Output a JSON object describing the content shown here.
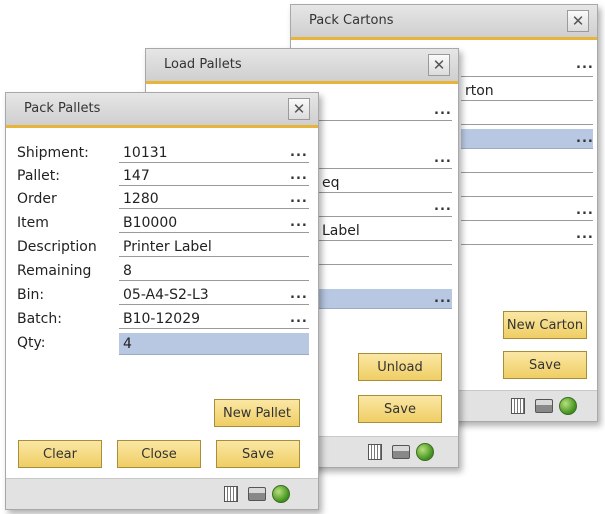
{
  "pack_cartons": {
    "title": "Pack Cartons",
    "partial_texts": [
      "rton"
    ],
    "buttons": {
      "new_carton": "New Carton",
      "save": "Save"
    }
  },
  "load_pallets": {
    "title": "Load Pallets",
    "partial_texts": [
      "eq",
      "Label"
    ],
    "buttons": {
      "unload": "Unload",
      "save": "Save"
    }
  },
  "pack_pallets": {
    "title": "Pack Pallets",
    "fields": [
      {
        "label": "Shipment:",
        "value": "10131",
        "has_lookup": true
      },
      {
        "label": "Pallet:",
        "value": "147",
        "has_lookup": true
      },
      {
        "label": "Order",
        "value": "1280",
        "has_lookup": true
      },
      {
        "label": "Item",
        "value": "B10000",
        "has_lookup": true
      },
      {
        "label": "Description",
        "value": "Printer Label",
        "has_lookup": false
      },
      {
        "label": "Remaining",
        "value": "8",
        "has_lookup": false
      },
      {
        "label": "Bin:",
        "value": "05-A4-S2-L3",
        "has_lookup": true
      },
      {
        "label": "Batch:",
        "value": "B10-12029",
        "has_lookup": true
      },
      {
        "label": "Qty:",
        "value": "4",
        "has_lookup": false,
        "highlighted": true
      }
    ],
    "buttons": {
      "new_pallet": "New Pallet",
      "clear": "Clear",
      "close": "Close",
      "save": "Save"
    }
  },
  "ui": {
    "close_glyph": "✕",
    "lookup_glyph": "..."
  },
  "colors": {
    "accent_bar": "#e8b43a",
    "button_fill": "#efce64",
    "highlight_field": "#b8c8e2",
    "status_ok": "#3f8f1e"
  },
  "icons": [
    "calculator-icon",
    "printer-icon",
    "status-ok-icon"
  ]
}
